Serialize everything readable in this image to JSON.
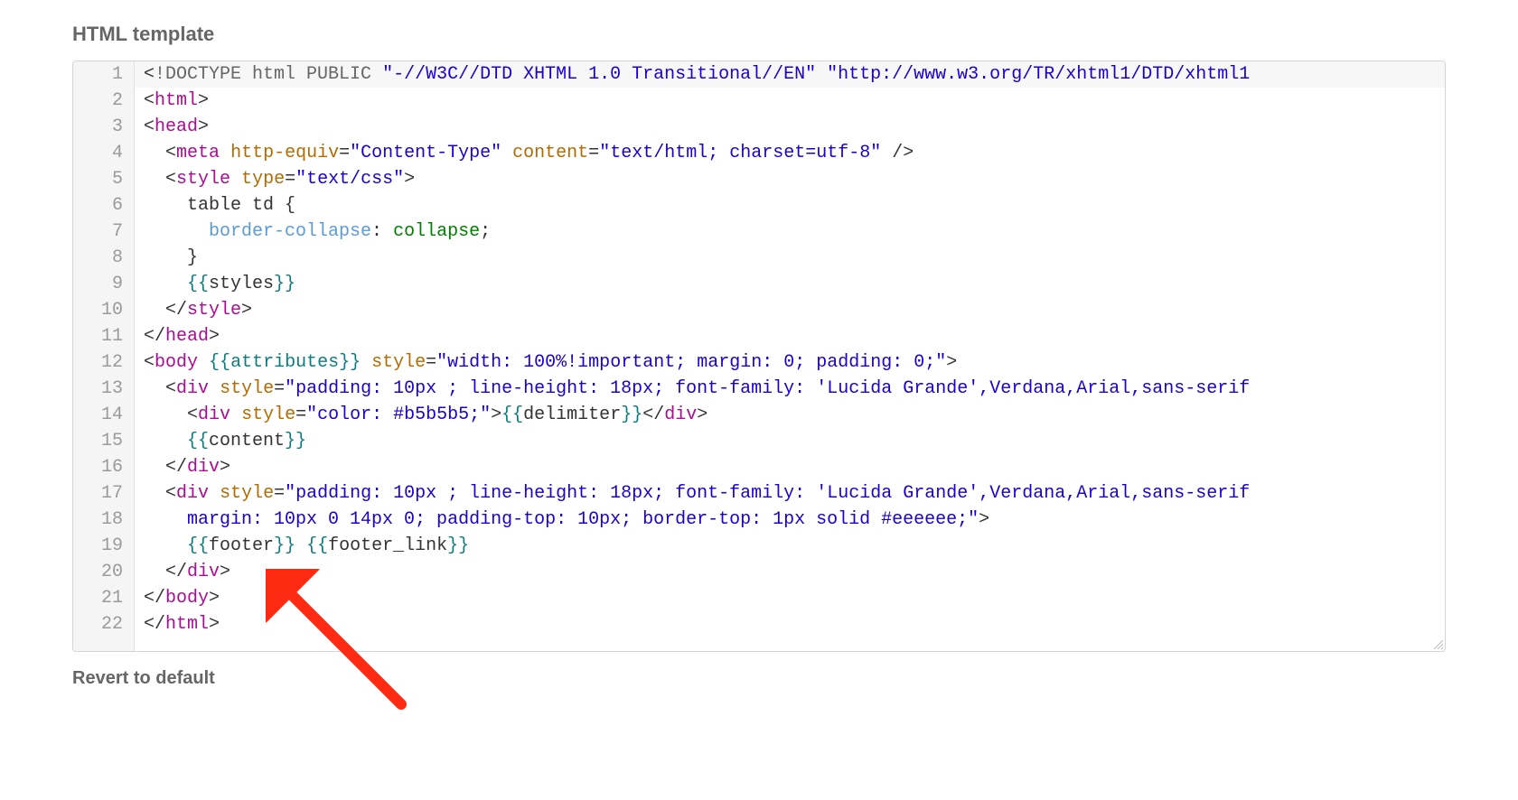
{
  "section": {
    "title": "HTML template",
    "revert_label": "Revert to default"
  },
  "editor": {
    "active_line": 1,
    "lines": [
      {
        "num": "1",
        "tokens": [
          {
            "t": "<",
            "c": "tk-punct"
          },
          {
            "t": "!DOCTYPE html PUBLIC ",
            "c": "tk-doctype-kw"
          },
          {
            "t": "\"-//W3C//DTD XHTML 1.0 Transitional//EN\"",
            "c": "tk-string"
          },
          {
            "t": " ",
            "c": "tk-text"
          },
          {
            "t": "\"http://www.w3.org/TR/xhtml1/DTD/xhtml1",
            "c": "tk-string"
          }
        ]
      },
      {
        "num": "2",
        "tokens": [
          {
            "t": "<",
            "c": "tk-punct"
          },
          {
            "t": "html",
            "c": "tk-tag"
          },
          {
            "t": ">",
            "c": "tk-punct"
          }
        ]
      },
      {
        "num": "3",
        "tokens": [
          {
            "t": "<",
            "c": "tk-punct"
          },
          {
            "t": "head",
            "c": "tk-tag"
          },
          {
            "t": ">",
            "c": "tk-punct"
          }
        ]
      },
      {
        "num": "4",
        "tokens": [
          {
            "t": "  ",
            "c": "tk-text"
          },
          {
            "t": "<",
            "c": "tk-punct"
          },
          {
            "t": "meta",
            "c": "tk-tag"
          },
          {
            "t": " ",
            "c": "tk-text"
          },
          {
            "t": "http-equiv",
            "c": "tk-attr-eq"
          },
          {
            "t": "=",
            "c": "tk-punct"
          },
          {
            "t": "\"Content-Type\"",
            "c": "tk-string"
          },
          {
            "t": " ",
            "c": "tk-text"
          },
          {
            "t": "content",
            "c": "tk-attr-eq"
          },
          {
            "t": "=",
            "c": "tk-punct"
          },
          {
            "t": "\"text/html; charset=utf-8\"",
            "c": "tk-string"
          },
          {
            "t": " />",
            "c": "tk-punct"
          }
        ]
      },
      {
        "num": "5",
        "tokens": [
          {
            "t": "  ",
            "c": "tk-text"
          },
          {
            "t": "<",
            "c": "tk-punct"
          },
          {
            "t": "style",
            "c": "tk-tag"
          },
          {
            "t": " ",
            "c": "tk-text"
          },
          {
            "t": "type",
            "c": "tk-attr-eq"
          },
          {
            "t": "=",
            "c": "tk-punct"
          },
          {
            "t": "\"text/css\"",
            "c": "tk-string"
          },
          {
            "t": ">",
            "c": "tk-punct"
          }
        ]
      },
      {
        "num": "6",
        "tokens": [
          {
            "t": "    table td {",
            "c": "tk-text"
          }
        ]
      },
      {
        "num": "7",
        "tokens": [
          {
            "t": "      ",
            "c": "tk-text"
          },
          {
            "t": "border-collapse",
            "c": "tk-css-prop"
          },
          {
            "t": ": ",
            "c": "tk-text"
          },
          {
            "t": "collapse",
            "c": "tk-css-val"
          },
          {
            "t": ";",
            "c": "tk-text"
          }
        ]
      },
      {
        "num": "8",
        "tokens": [
          {
            "t": "    }",
            "c": "tk-text"
          }
        ]
      },
      {
        "num": "9",
        "tokens": [
          {
            "t": "    ",
            "c": "tk-text"
          },
          {
            "t": "{{",
            "c": "tk-mustache-br"
          },
          {
            "t": "styles",
            "c": "tk-mustache-id"
          },
          {
            "t": "}}",
            "c": "tk-mustache-br"
          }
        ]
      },
      {
        "num": "10",
        "tokens": [
          {
            "t": "  ",
            "c": "tk-text"
          },
          {
            "t": "</",
            "c": "tk-punct"
          },
          {
            "t": "style",
            "c": "tk-tag"
          },
          {
            "t": ">",
            "c": "tk-punct"
          }
        ]
      },
      {
        "num": "11",
        "tokens": [
          {
            "t": "</",
            "c": "tk-punct"
          },
          {
            "t": "head",
            "c": "tk-tag"
          },
          {
            "t": ">",
            "c": "tk-punct"
          }
        ]
      },
      {
        "num": "12",
        "tokens": [
          {
            "t": "<",
            "c": "tk-punct"
          },
          {
            "t": "body",
            "c": "tk-tag"
          },
          {
            "t": " ",
            "c": "tk-text"
          },
          {
            "t": "{{",
            "c": "tk-mustache-br"
          },
          {
            "t": "attributes",
            "c": "tk-mustache-attr"
          },
          {
            "t": "}}",
            "c": "tk-mustache-br"
          },
          {
            "t": " ",
            "c": "tk-text"
          },
          {
            "t": "style",
            "c": "tk-attr-eq"
          },
          {
            "t": "=",
            "c": "tk-punct"
          },
          {
            "t": "\"width: 100%!important; margin: 0; padding: 0;\"",
            "c": "tk-string"
          },
          {
            "t": ">",
            "c": "tk-punct"
          }
        ]
      },
      {
        "num": "13",
        "tokens": [
          {
            "t": "  ",
            "c": "tk-text"
          },
          {
            "t": "<",
            "c": "tk-punct"
          },
          {
            "t": "div",
            "c": "tk-tag"
          },
          {
            "t": " ",
            "c": "tk-text"
          },
          {
            "t": "style",
            "c": "tk-attr-eq"
          },
          {
            "t": "=",
            "c": "tk-punct"
          },
          {
            "t": "\"padding: 10px ; line-height: 18px; font-family: 'Lucida Grande',Verdana,Arial,sans-serif",
            "c": "tk-string"
          }
        ]
      },
      {
        "num": "14",
        "tokens": [
          {
            "t": "    ",
            "c": "tk-text"
          },
          {
            "t": "<",
            "c": "tk-punct"
          },
          {
            "t": "div",
            "c": "tk-tag"
          },
          {
            "t": " ",
            "c": "tk-text"
          },
          {
            "t": "style",
            "c": "tk-attr-eq"
          },
          {
            "t": "=",
            "c": "tk-punct"
          },
          {
            "t": "\"color: #b5b5b5;\"",
            "c": "tk-string"
          },
          {
            "t": ">",
            "c": "tk-punct"
          },
          {
            "t": "{{",
            "c": "tk-mustache-br"
          },
          {
            "t": "delimiter",
            "c": "tk-mustache-id"
          },
          {
            "t": "}}",
            "c": "tk-mustache-br"
          },
          {
            "t": "</",
            "c": "tk-punct"
          },
          {
            "t": "div",
            "c": "tk-tag"
          },
          {
            "t": ">",
            "c": "tk-punct"
          }
        ]
      },
      {
        "num": "15",
        "tokens": [
          {
            "t": "    ",
            "c": "tk-text"
          },
          {
            "t": "{{",
            "c": "tk-mustache-br"
          },
          {
            "t": "content",
            "c": "tk-mustache-id"
          },
          {
            "t": "}}",
            "c": "tk-mustache-br"
          }
        ]
      },
      {
        "num": "16",
        "tokens": [
          {
            "t": "  ",
            "c": "tk-text"
          },
          {
            "t": "</",
            "c": "tk-punct"
          },
          {
            "t": "div",
            "c": "tk-tag"
          },
          {
            "t": ">",
            "c": "tk-punct"
          }
        ]
      },
      {
        "num": "17",
        "tokens": [
          {
            "t": "  ",
            "c": "tk-text"
          },
          {
            "t": "<",
            "c": "tk-punct"
          },
          {
            "t": "div",
            "c": "tk-tag"
          },
          {
            "t": " ",
            "c": "tk-text"
          },
          {
            "t": "style",
            "c": "tk-attr-eq"
          },
          {
            "t": "=",
            "c": "tk-punct"
          },
          {
            "t": "\"padding: 10px ; line-height: 18px; font-family: 'Lucida Grande',Verdana,Arial,sans-serif",
            "c": "tk-string"
          }
        ]
      },
      {
        "num": "18",
        "tokens": [
          {
            "t": "    ",
            "c": "tk-text"
          },
          {
            "t": "margin: 10px 0 14px 0; padding-top: 10px; border-top: 1px solid #eeeeee;\"",
            "c": "tk-string"
          },
          {
            "t": ">",
            "c": "tk-punct"
          }
        ]
      },
      {
        "num": "19",
        "tokens": [
          {
            "t": "    ",
            "c": "tk-text"
          },
          {
            "t": "{{",
            "c": "tk-mustache-br"
          },
          {
            "t": "footer",
            "c": "tk-mustache-id"
          },
          {
            "t": "}}",
            "c": "tk-mustache-br"
          },
          {
            "t": " ",
            "c": "tk-text"
          },
          {
            "t": "{{",
            "c": "tk-mustache-br"
          },
          {
            "t": "footer_link",
            "c": "tk-mustache-id"
          },
          {
            "t": "}}",
            "c": "tk-mustache-br"
          }
        ]
      },
      {
        "num": "20",
        "tokens": [
          {
            "t": "  ",
            "c": "tk-text"
          },
          {
            "t": "</",
            "c": "tk-punct"
          },
          {
            "t": "div",
            "c": "tk-tag"
          },
          {
            "t": ">",
            "c": "tk-punct"
          }
        ]
      },
      {
        "num": "21",
        "tokens": [
          {
            "t": "</",
            "c": "tk-punct"
          },
          {
            "t": "body",
            "c": "tk-tag"
          },
          {
            "t": ">",
            "c": "tk-punct"
          }
        ]
      },
      {
        "num": "22",
        "tokens": [
          {
            "t": "</",
            "c": "tk-punct"
          },
          {
            "t": "html",
            "c": "tk-tag"
          },
          {
            "t": ">",
            "c": "tk-punct"
          }
        ]
      }
    ]
  },
  "annotation": {
    "arrow_color": "#ff2a12"
  }
}
